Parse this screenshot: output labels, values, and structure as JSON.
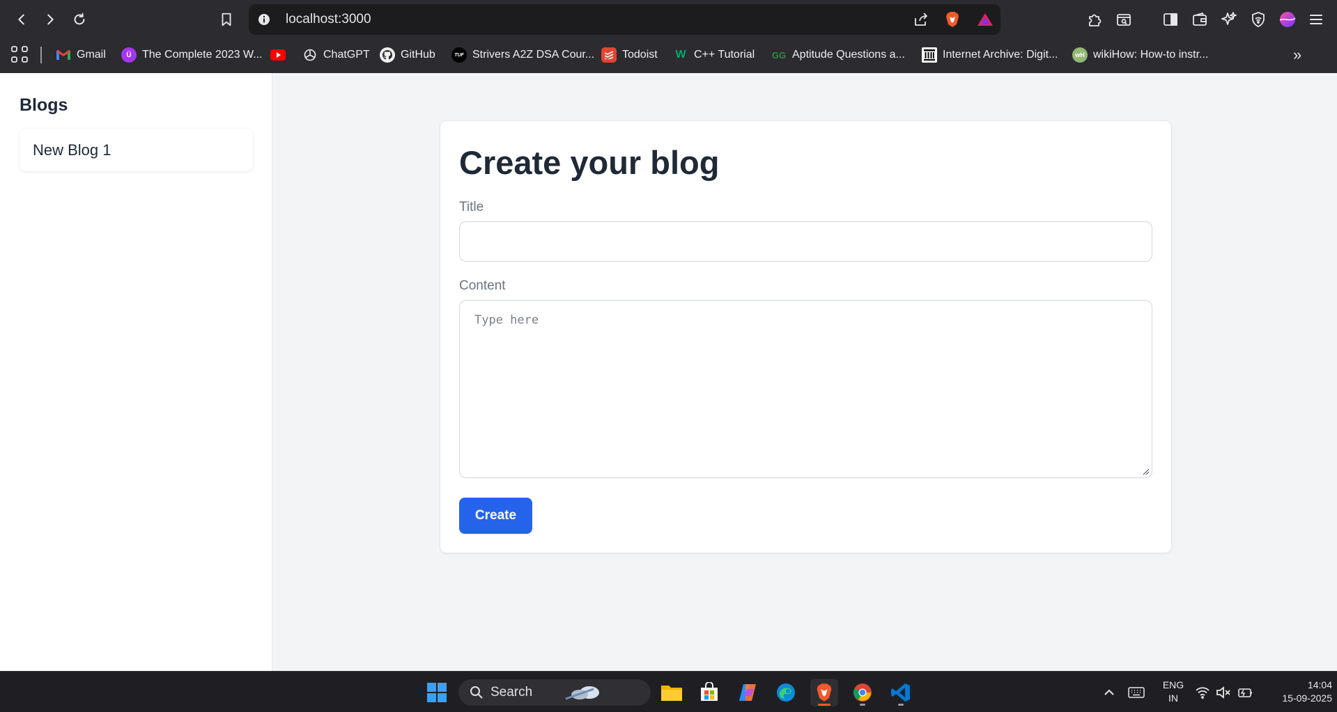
{
  "browser": {
    "url": "localhost:3000",
    "bookmarks": [
      {
        "label": "Gmail",
        "color": "#ea4335"
      },
      {
        "label": "The Complete 2023 W...",
        "color": "#a435f0"
      },
      {
        "label": "",
        "color": "#ff0000"
      },
      {
        "label": "ChatGPT",
        "color": "#3a3a3a"
      },
      {
        "label": "GitHub",
        "color": "#3a3a3a"
      },
      {
        "label": "Strivers A2Z DSA Cour...",
        "color": "#000000"
      },
      {
        "label": "Todoist",
        "color": "#e44332"
      },
      {
        "label": "C++ Tutorial",
        "color": "#04aa6d"
      },
      {
        "label": "Aptitude Questions a...",
        "color": "#2f8d46"
      },
      {
        "label": "Internet Archive: Digit...",
        "color": "#ffffff"
      },
      {
        "label": "wikiHow: How-to instr...",
        "color": "#93b874"
      }
    ]
  },
  "sidebar": {
    "title": "Blogs",
    "items": [
      {
        "label": "New Blog 1"
      }
    ]
  },
  "form": {
    "heading": "Create your blog",
    "title_label": "Title",
    "title_value": "",
    "content_label": "Content",
    "content_placeholder": "Type here",
    "submit_label": "Create"
  },
  "taskbar": {
    "search_placeholder": "Search",
    "lang_top": "ENG",
    "lang_bottom": "IN",
    "time": "14:04",
    "date": "15-09-2025"
  },
  "colors": {
    "accent": "#2563eb",
    "page_bg": "#f3f4f6"
  }
}
